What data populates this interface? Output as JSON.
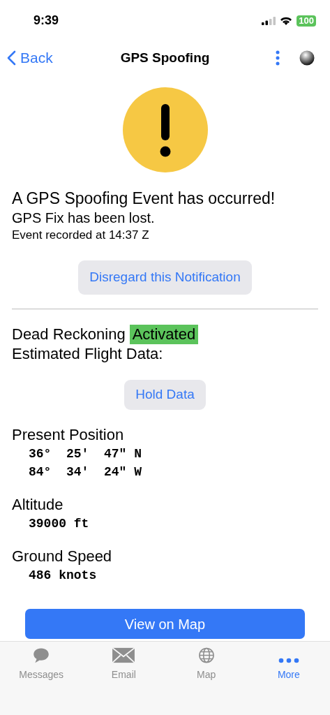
{
  "status_bar": {
    "time": "9:39",
    "battery": "100"
  },
  "nav": {
    "back": "Back",
    "title": "GPS Spoofing"
  },
  "alert": {
    "headline": "A GPS Spoofing Event has occurred!",
    "detail": "GPS Fix has been lost.",
    "recorded": "Event recorded at 14:37 Z",
    "button": "Disregard this Notification"
  },
  "dead_reckoning": {
    "label": "Dead Reckoning",
    "status": "Activated",
    "active": true,
    "subtitle": "Estimated Flight Data:",
    "button": "Hold Data"
  },
  "fields": [
    {
      "label": "Present Position",
      "values": [
        "36°  25'  47\" N",
        "84°  34'  24\" W"
      ]
    },
    {
      "label": "Altitude",
      "values": [
        "39000 ft"
      ]
    },
    {
      "label": "Ground Speed",
      "values": [
        "486 knots"
      ]
    }
  ],
  "map_button": "View on Map",
  "tabs": [
    {
      "kind": "messages",
      "label": "Messages",
      "selected": false
    },
    {
      "kind": "email",
      "label": "Email",
      "selected": false
    },
    {
      "kind": "map",
      "label": "Map",
      "selected": false
    },
    {
      "kind": "more",
      "label": "More",
      "selected": true
    }
  ]
}
